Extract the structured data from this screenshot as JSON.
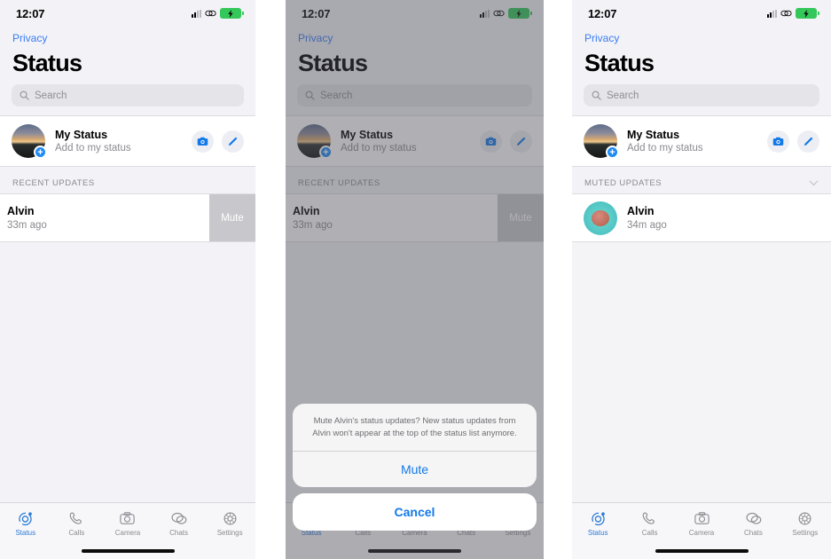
{
  "statusbar": {
    "time": "12:07",
    "icons": [
      "signal-bars-icon",
      "link-icon",
      "battery-charging-icon"
    ]
  },
  "common": {
    "back_link": "Privacy",
    "page_title": "Status",
    "search_placeholder": "Search",
    "my_status_title": "My Status",
    "my_status_subtitle": "Add to my status",
    "camera_button_label": "camera",
    "edit_button_label": "edit",
    "accent_blue": "#1479e8",
    "swipe_gray": "#c7c7cc",
    "battery_green": "#34c759"
  },
  "tabbar": {
    "items": [
      {
        "label": "Status",
        "icon": "status-ring-icon",
        "active": true
      },
      {
        "label": "Calls",
        "icon": "phone-icon",
        "active": false
      },
      {
        "label": "Camera",
        "icon": "camera-icon",
        "active": false
      },
      {
        "label": "Chats",
        "icon": "chat-bubble-icon",
        "active": false
      },
      {
        "label": "Settings",
        "icon": "gear-icon",
        "active": false
      }
    ]
  },
  "panel1": {
    "section_header": "RECENT UPDATES",
    "row": {
      "name": "Alvin",
      "time": "33m ago"
    },
    "swipe_action_label": "Mute"
  },
  "panel2": {
    "section_header": "RECENT UPDATES",
    "row": {
      "name": "Alvin",
      "time": "33m ago"
    },
    "swipe_action_label": "Mute",
    "sheet": {
      "message": "Mute Alvin's status updates? New status updates from Alvin won't appear at the top of the status list anymore.",
      "confirm_label": "Mute",
      "cancel_label": "Cancel"
    }
  },
  "panel3": {
    "section_header": "MUTED UPDATES",
    "collapse_icon": "chevron-down-icon",
    "row": {
      "name": "Alvin",
      "time": "34m ago"
    }
  }
}
